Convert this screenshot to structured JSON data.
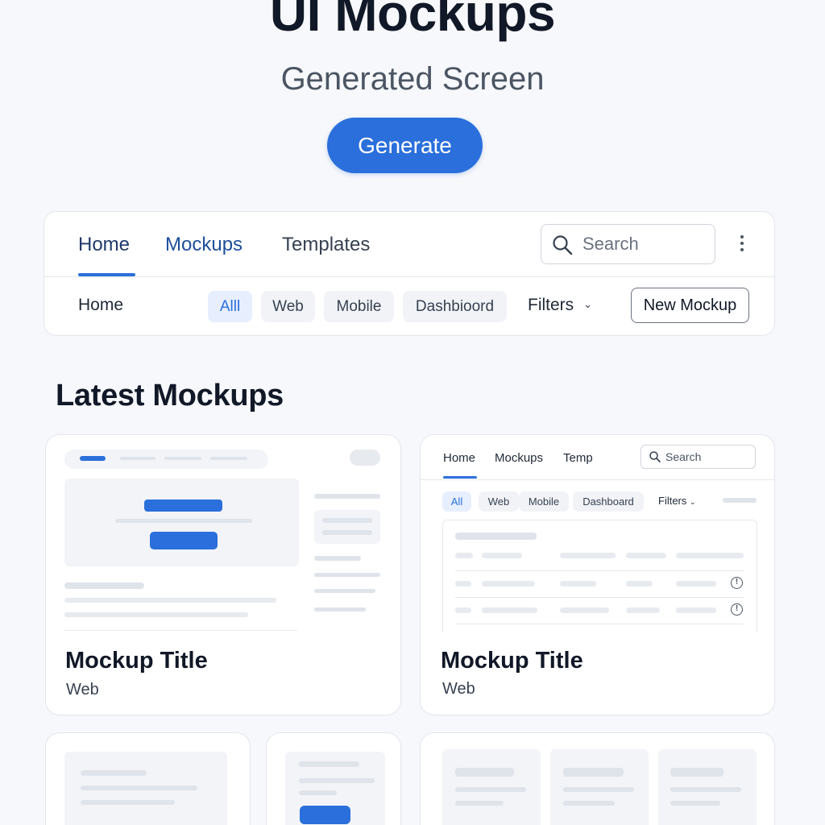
{
  "hero": {
    "title": "UI Mockups",
    "subtitle": "Generated Screen",
    "generate_label": "Generate"
  },
  "nav": {
    "tabs": [
      {
        "label": "Home",
        "active": true
      },
      {
        "label": "Mockups",
        "active": false
      },
      {
        "label": "Templates",
        "active": false
      }
    ],
    "search_placeholder": "Search",
    "breadcrumb": "Home",
    "chips": [
      {
        "label": "Alll",
        "active": true
      },
      {
        "label": "Web",
        "active": false
      },
      {
        "label": "Mobile",
        "active": false
      },
      {
        "label": "Dashbioord",
        "active": false
      }
    ],
    "filters_label": "Filters",
    "new_mockup_label": "New Mockup"
  },
  "section": {
    "title": "Latest Mockups"
  },
  "cards": [
    {
      "title": "Mockup Title",
      "subtitle": "Web"
    },
    {
      "title": "Mockup Title",
      "subtitle": "Web",
      "preview": {
        "tabs": [
          "Home",
          "Mockups",
          "Temp"
        ],
        "search_placeholder": "Search",
        "chips": [
          "All",
          "Web",
          "Mobile",
          "Dashboard"
        ],
        "filters_label": "Filters"
      }
    }
  ],
  "colors": {
    "accent": "#2a6fdb",
    "background": "#f7f8fb",
    "text": "#111827"
  }
}
